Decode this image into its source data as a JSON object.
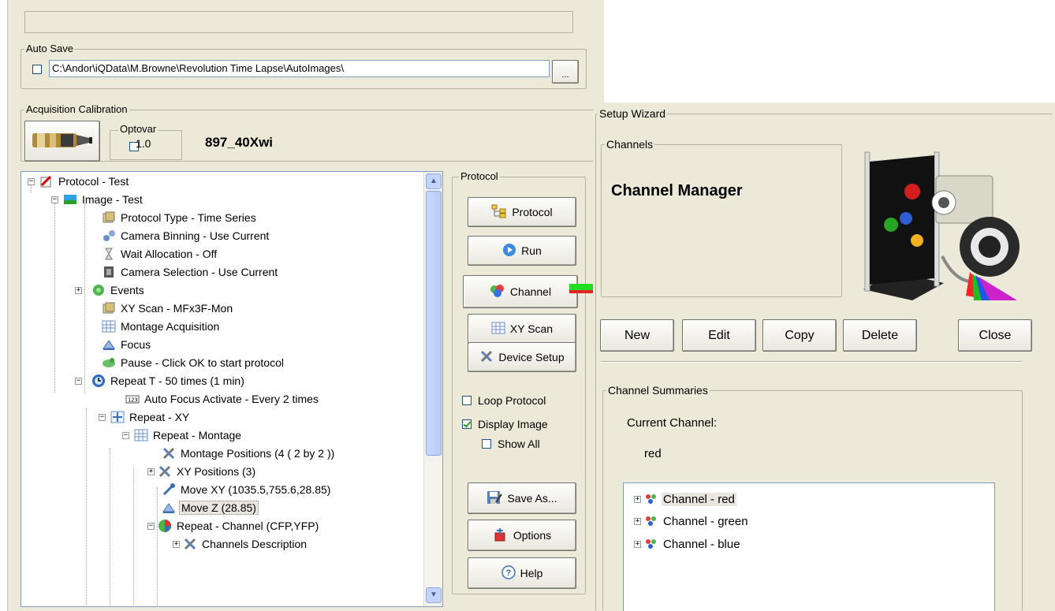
{
  "auto_save": {
    "legend": "Auto Save",
    "enabled": false,
    "path": "C:\\Andor\\iQData\\M.Browne\\Revolution Time Lapse\\AutoImages\\",
    "browse_label": "..."
  },
  "calibration": {
    "legend": "Acquisition Calibration",
    "optovar_legend": "Optovar",
    "optovar_value": "1.0",
    "calibration_name": "897_40Xwi"
  },
  "tree": {
    "items": [
      {
        "label": "Protocol - Test",
        "icon": "protocol-icon"
      },
      {
        "label": "Image - Test",
        "icon": "image-icon"
      },
      {
        "label": "Protocol Type - Time Series",
        "icon": "protocol-type-icon"
      },
      {
        "label": "Camera Binning - Use Current",
        "icon": "binning-icon"
      },
      {
        "label": "Wait Allocation - Off",
        "icon": "hourglass-icon"
      },
      {
        "label": "Camera Selection - Use Current",
        "icon": "camera-icon"
      },
      {
        "label": "Events",
        "icon": "events-icon"
      },
      {
        "label": "XY Scan - MFx3F-Mon",
        "icon": "xy-scan-icon"
      },
      {
        "label": "Montage Acquisition",
        "icon": "montage-icon"
      },
      {
        "label": "Focus",
        "icon": "focus-icon"
      },
      {
        "label": "Pause - Click OK to start protocol",
        "icon": "pause-icon"
      },
      {
        "label": "Repeat T - 50 times (1 min)",
        "icon": "clock-icon"
      },
      {
        "label": "Auto Focus Activate - Every 2 times",
        "icon": "autofocus-icon"
      },
      {
        "label": "Repeat - XY",
        "icon": "repeat-xy-icon"
      },
      {
        "label": "Repeat - Montage",
        "icon": "montage-icon"
      },
      {
        "label": "Montage Positions (4 ( 2 by 2 ))",
        "icon": "tools-icon"
      },
      {
        "label": "XY Positions (3)",
        "icon": "tools-icon"
      },
      {
        "label": "Move XY (1035.5,755.6,28.85)",
        "icon": "move-xy-icon"
      },
      {
        "label": "Move Z (28.85)",
        "icon": "move-z-icon"
      },
      {
        "label": "Repeat - Channel (CFP,YFP)",
        "icon": "channel-repeat-icon"
      },
      {
        "label": "Channels Description",
        "icon": "tools-icon"
      }
    ]
  },
  "protocol_panel": {
    "legend": "Protocol",
    "buttons": {
      "protocol": "Protocol",
      "run": "Run",
      "channel": "Channel",
      "xy_scan": "XY Scan",
      "device_setup": "Device Setup",
      "save_as": "Save As...",
      "options": "Options",
      "help": "Help"
    },
    "loop_protocol": {
      "label": "Loop Protocol",
      "checked": false
    },
    "display_image": {
      "label": "Display Image",
      "checked": true
    },
    "show_all": {
      "label": "Show All",
      "checked": false
    }
  },
  "wizard": {
    "legend": "Setup Wizard",
    "channels_legend": "Channels",
    "title": "Channel Manager",
    "buttons": {
      "new": "New",
      "edit": "Edit",
      "copy": "Copy",
      "delete": "Delete",
      "close": "Close"
    },
    "summaries_legend": "Channel Summaries",
    "current_channel_label": "Current Channel:",
    "current_channel_value": "red",
    "channel_list": [
      {
        "label": "Channel - red"
      },
      {
        "label": "Channel - green"
      },
      {
        "label": "Channel - blue"
      }
    ]
  },
  "colors": {
    "panel_bg": "#ece9d8",
    "arrow_green": "#22dd22",
    "arrow_red": "#e52222",
    "selection": "#e8e6df"
  }
}
